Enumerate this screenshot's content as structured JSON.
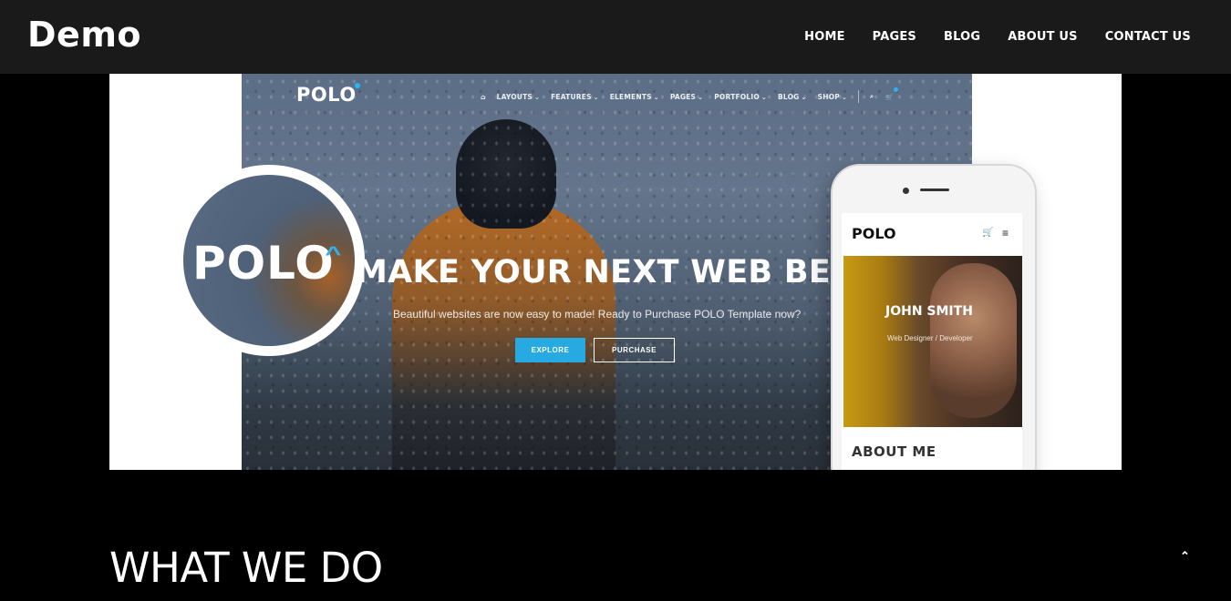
{
  "header": {
    "brand": "Demo",
    "nav": [
      "HOME",
      "PAGES",
      "BLOG",
      "ABOUT US",
      "CONTACT US"
    ]
  },
  "hero_image": {
    "site_logo": "POLO",
    "site_nav": [
      "LAYOUTS",
      "FEATURES",
      "ELEMENTS",
      "PAGES",
      "PORTFOLIO",
      "BLOG",
      "SHOP"
    ],
    "headline": "MAKE YOUR NEXT WEB BETTER",
    "subtext": "Beautiful websites are now easy to made! Ready to Purchase POLO Template now?",
    "explore_label": "EXPLORE",
    "purchase_label": "PURCHASE",
    "zoom_logo": "POLO",
    "phone": {
      "logo": "POLO",
      "name": "JOHN SMITH",
      "role": "Web Designer / Developer",
      "section": "ABOUT ME"
    }
  },
  "section": {
    "title": "WHAT WE DO"
  },
  "icons": {
    "home": "home-icon",
    "search": "search-icon",
    "cart": "cart-icon",
    "menu": "hamburger-menu-icon",
    "back_to_top": "chevron-up-icon"
  },
  "colors": {
    "header_bg": "#1a1a1a",
    "page_bg": "#000000",
    "accent": "#27a9e1"
  }
}
